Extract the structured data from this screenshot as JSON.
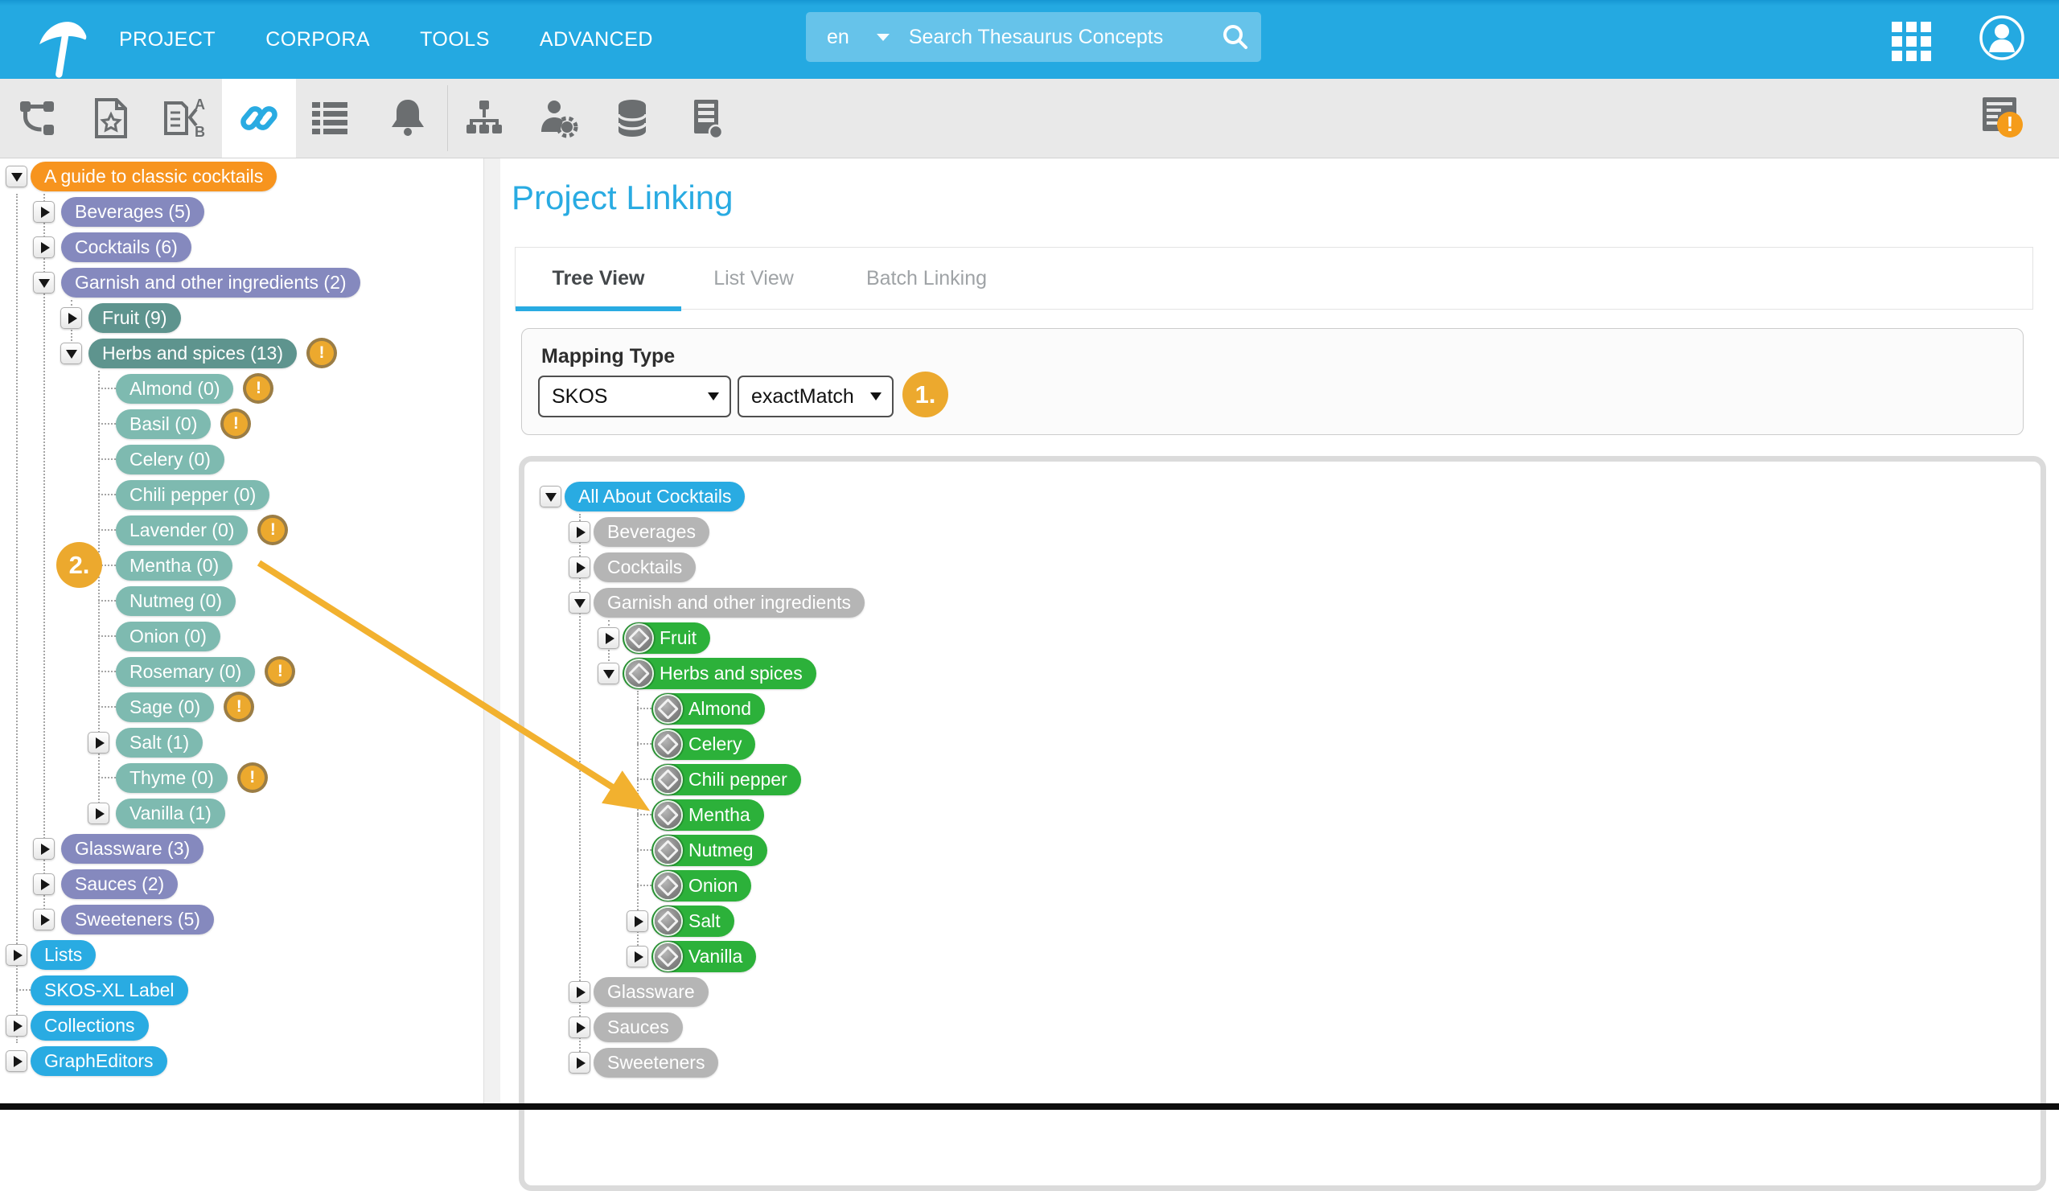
{
  "topbar": {
    "menu": [
      "PROJECT",
      "CORPORA",
      "TOOLS",
      "ADVANCED"
    ],
    "search": {
      "language": "en",
      "placeholder": "Search Thesaurus Concepts"
    }
  },
  "toolbar": {
    "icons": [
      "workflow-icon",
      "document-star-icon",
      "document-ab-sort-icon",
      "link-icon",
      "list-icon",
      "bell-icon",
      "orgchart-icon",
      "user-settings-icon",
      "database-icon",
      "server-icon",
      "report-alert-icon"
    ],
    "active_icon": "link-icon"
  },
  "main": {
    "page_title": "Project Linking",
    "tabs": [
      {
        "label": "Tree View",
        "active": true
      },
      {
        "label": "List View",
        "active": false
      },
      {
        "label": "Batch Linking",
        "active": false
      }
    ],
    "mapping": {
      "title": "Mapping Type",
      "scheme": "SKOS",
      "relation": "exactMatch"
    }
  },
  "annotations": {
    "step1": "1.",
    "step2": "2."
  },
  "badge_char": "!",
  "left_tree": {
    "nodes": [
      {
        "label": "A guide to classic cocktails",
        "level": 0,
        "color": "orange",
        "exp": "open"
      },
      {
        "label": "Beverages (5)",
        "level": 1,
        "color": "purple",
        "exp": "closed"
      },
      {
        "label": "Cocktails (6)",
        "level": 1,
        "color": "purple",
        "exp": "closed"
      },
      {
        "label": "Garnish and other ingredients (2)",
        "level": 1,
        "color": "purple",
        "exp": "open"
      },
      {
        "label": "Fruit (9)",
        "level": 2,
        "color": "teal",
        "exp": "closed"
      },
      {
        "label": "Herbs and spices (13)",
        "level": 2,
        "color": "teal",
        "exp": "open",
        "badge": true
      },
      {
        "label": "Almond (0)",
        "level": 3,
        "color": "teal_light",
        "exp": "stub",
        "badge": true
      },
      {
        "label": "Basil (0)",
        "level": 3,
        "color": "teal_light",
        "exp": "stub",
        "badge": true
      },
      {
        "label": "Celery (0)",
        "level": 3,
        "color": "teal_light",
        "exp": "stub"
      },
      {
        "label": "Chili pepper (0)",
        "level": 3,
        "color": "teal_light",
        "exp": "stub"
      },
      {
        "label": "Lavender (0)",
        "level": 3,
        "color": "teal_light",
        "exp": "stub",
        "badge": true
      },
      {
        "label": "Mentha (0)",
        "level": 3,
        "color": "teal_light",
        "exp": "stub"
      },
      {
        "label": "Nutmeg (0)",
        "level": 3,
        "color": "teal_light",
        "exp": "stub"
      },
      {
        "label": "Onion (0)",
        "level": 3,
        "color": "teal_light",
        "exp": "stub"
      },
      {
        "label": "Rosemary (0)",
        "level": 3,
        "color": "teal_light",
        "exp": "stub",
        "badge": true
      },
      {
        "label": "Sage (0)",
        "level": 3,
        "color": "teal_light",
        "exp": "stub",
        "badge": true
      },
      {
        "label": "Salt (1)",
        "level": 3,
        "color": "teal_light",
        "exp": "closed"
      },
      {
        "label": "Thyme (0)",
        "level": 3,
        "color": "teal_light",
        "exp": "stub",
        "badge": true
      },
      {
        "label": "Vanilla (1)",
        "level": 3,
        "color": "teal_light",
        "exp": "closed"
      },
      {
        "label": "Glassware (3)",
        "level": 1,
        "color": "purple",
        "exp": "closed"
      },
      {
        "label": "Sauces (2)",
        "level": 1,
        "color": "purple",
        "exp": "closed"
      },
      {
        "label": "Sweeteners (5)",
        "level": 1,
        "color": "purple",
        "exp": "closed"
      },
      {
        "label": "Lists",
        "level": 0,
        "color": "blue",
        "exp": "closed"
      },
      {
        "label": "SKOS-XL Label",
        "level": 0,
        "color": "blue",
        "exp": "stub"
      },
      {
        "label": "Collections",
        "level": 0,
        "color": "blue",
        "exp": "closed"
      },
      {
        "label": "GraphEditors",
        "level": 0,
        "color": "blue",
        "exp": "closed"
      }
    ]
  },
  "right_tree": {
    "nodes": [
      {
        "label": "All About Cocktails",
        "level": 0,
        "color": "blue",
        "exp": "open"
      },
      {
        "label": "Beverages",
        "level": 1,
        "color": "gray",
        "exp": "closed"
      },
      {
        "label": "Cocktails",
        "level": 1,
        "color": "gray",
        "exp": "closed"
      },
      {
        "label": "Garnish and other ingredients",
        "level": 1,
        "color": "gray",
        "exp": "open"
      },
      {
        "label": "Fruit",
        "level": 2,
        "color": "green",
        "exp": "closed",
        "icon": true
      },
      {
        "label": "Herbs and spices",
        "level": 2,
        "color": "green",
        "exp": "open",
        "icon": true
      },
      {
        "label": "Almond",
        "level": 3,
        "color": "green",
        "exp": "stub",
        "icon": true
      },
      {
        "label": "Celery",
        "level": 3,
        "color": "green",
        "exp": "stub",
        "icon": true
      },
      {
        "label": "Chili pepper",
        "level": 3,
        "color": "green",
        "exp": "stub",
        "icon": true
      },
      {
        "label": "Mentha",
        "level": 3,
        "color": "green",
        "exp": "stub",
        "icon": true
      },
      {
        "label": "Nutmeg",
        "level": 3,
        "color": "green",
        "exp": "stub",
        "icon": true
      },
      {
        "label": "Onion",
        "level": 3,
        "color": "green",
        "exp": "stub",
        "icon": true
      },
      {
        "label": "Salt",
        "level": 3,
        "color": "green",
        "exp": "closed",
        "icon": true
      },
      {
        "label": "Vanilla",
        "level": 3,
        "color": "green",
        "exp": "closed",
        "icon": true
      },
      {
        "label": "Glassware",
        "level": 1,
        "color": "gray",
        "exp": "closed"
      },
      {
        "label": "Sauces",
        "level": 1,
        "color": "gray",
        "exp": "closed"
      },
      {
        "label": "Sweeteners",
        "level": 1,
        "color": "gray",
        "exp": "closed"
      }
    ]
  },
  "colors": {
    "brand_blue": "#29ABE2",
    "orange": "#F7941E",
    "purple": "#8589BE",
    "teal": "#5E948E",
    "teal_light": "#7EBAB0",
    "gray_pill": "#B5B5B5",
    "green": "#2CB13A",
    "amber": "#ECA92E",
    "arrow": "#F2B12F",
    "toolbar_icon": "#6B6E70"
  }
}
